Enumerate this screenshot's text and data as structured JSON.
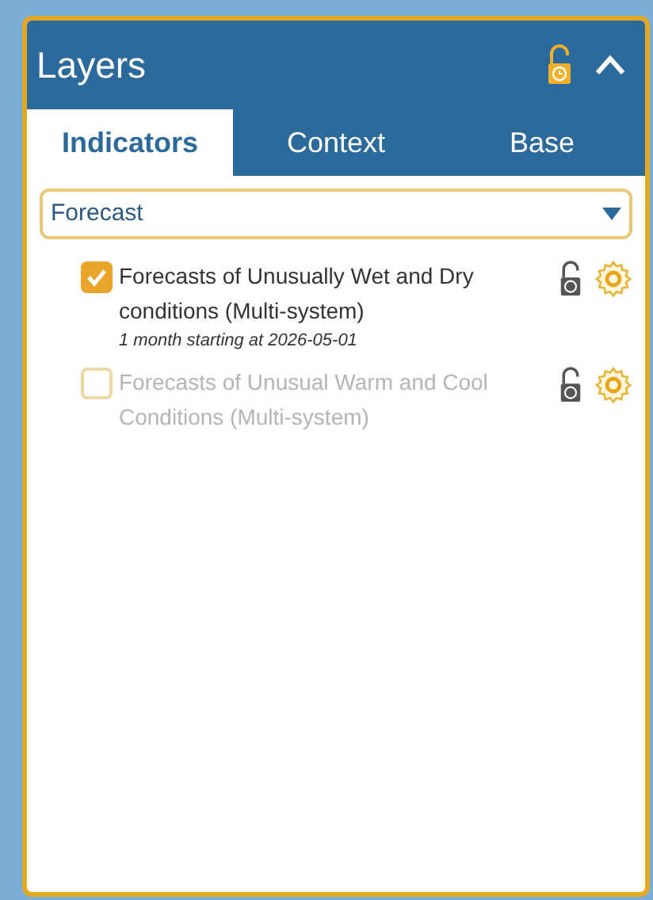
{
  "panel": {
    "title": "Layers",
    "locked": false,
    "expanded": true
  },
  "tabs": [
    {
      "label": "Indicators",
      "selected": true
    },
    {
      "label": "Context",
      "selected": false
    },
    {
      "label": "Base",
      "selected": false
    }
  ],
  "category_select": {
    "value": "Forecast"
  },
  "layers": [
    {
      "name": "Forecasts of Unusually Wet and Dry conditions (Multi-system)",
      "subtitle": "1 month starting at 2026-05-01",
      "checked": true
    },
    {
      "name": "Forecasts of Unusual Warm and Cool Conditions (Multi-system)",
      "checked": false
    }
  ]
}
